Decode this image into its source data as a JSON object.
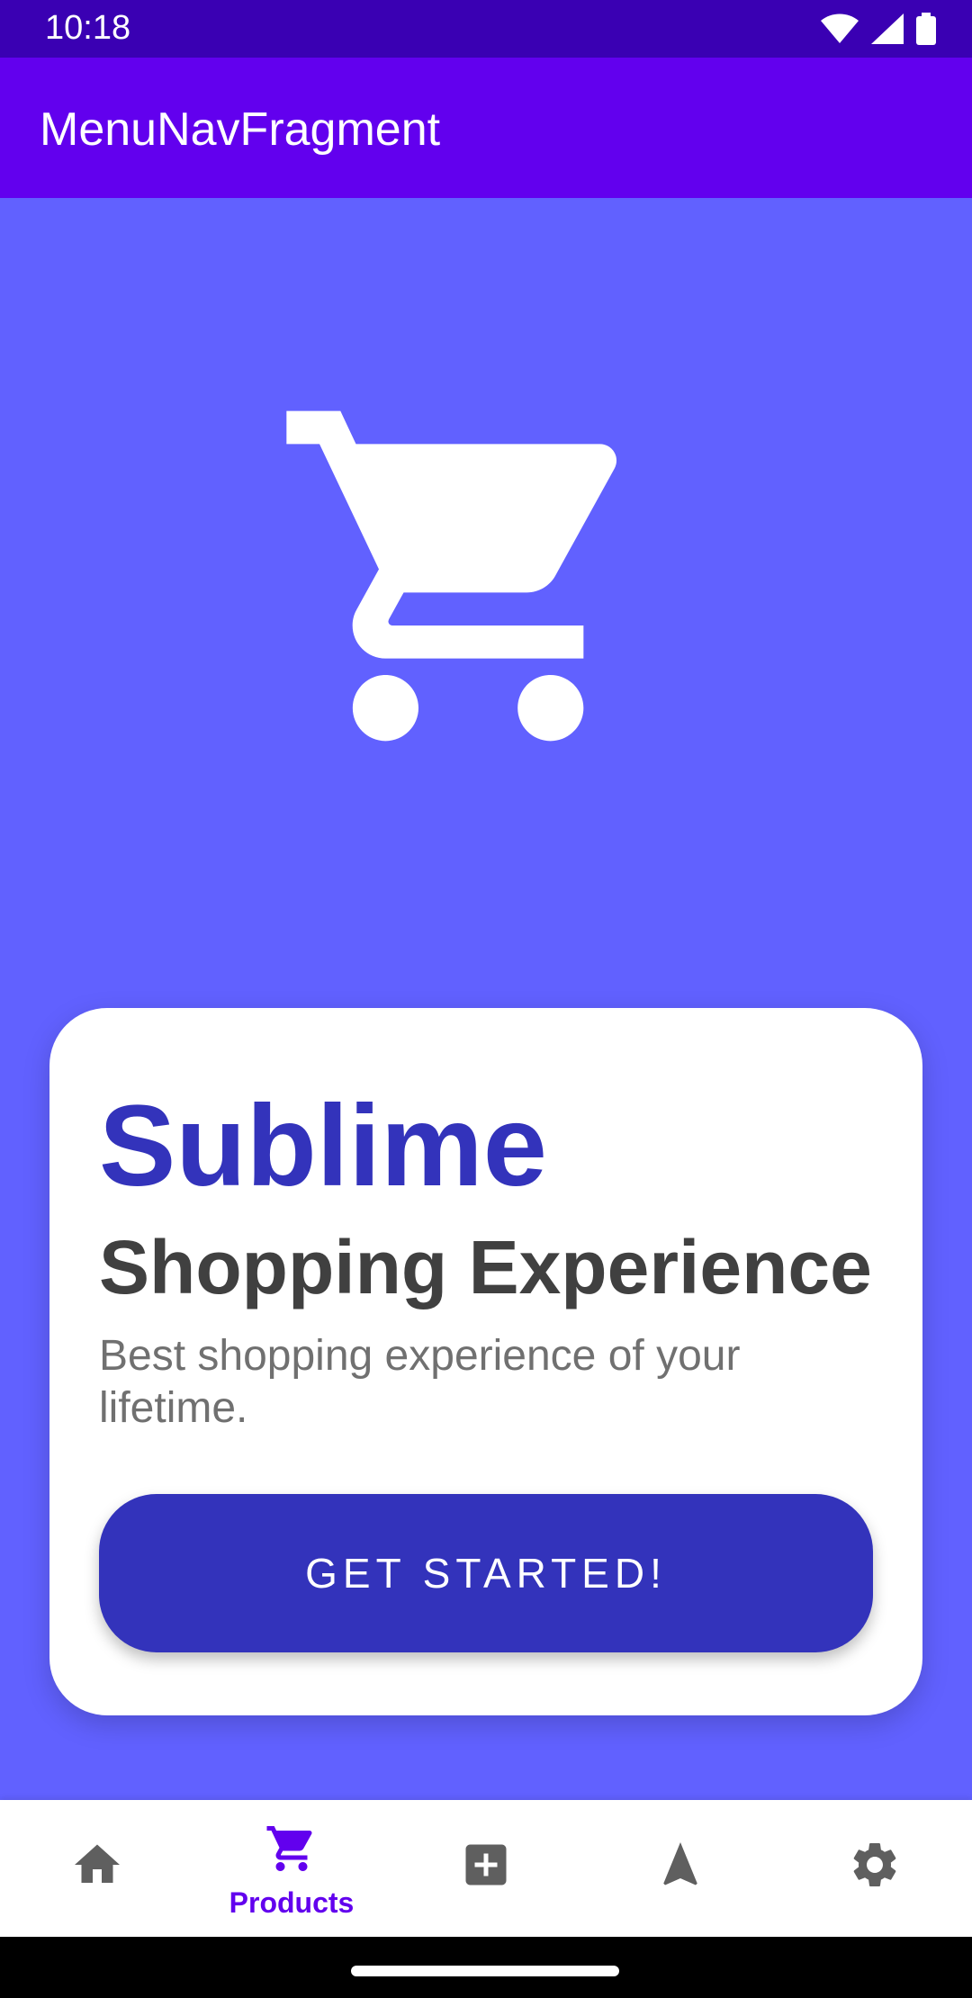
{
  "status_bar": {
    "time": "10:18",
    "icons": [
      "wifi-icon",
      "signal-icon",
      "battery-icon"
    ]
  },
  "app_bar": {
    "title": "MenuNavFragment"
  },
  "hero": {
    "icon": "shopping-cart-icon"
  },
  "card": {
    "title": "Sublime",
    "subtitle": "Shopping Experience",
    "description": "Best shopping experience of your lifetime.",
    "cta_label": "GET STARTED!"
  },
  "bottom_nav": {
    "items": [
      {
        "icon": "home-icon",
        "label": "",
        "active": false
      },
      {
        "icon": "cart-icon",
        "label": "Products",
        "active": true
      },
      {
        "icon": "add-box-icon",
        "label": "",
        "active": false
      },
      {
        "icon": "navigation-icon",
        "label": "",
        "active": false
      },
      {
        "icon": "settings-icon",
        "label": "",
        "active": false
      }
    ]
  },
  "colors": {
    "status_bar": "#3a00b3",
    "app_bar": "#6200ee",
    "background": "#6161ff",
    "accent": "#3333bb",
    "nav_active": "#6200ee",
    "nav_inactive": "#5f5f5f"
  }
}
